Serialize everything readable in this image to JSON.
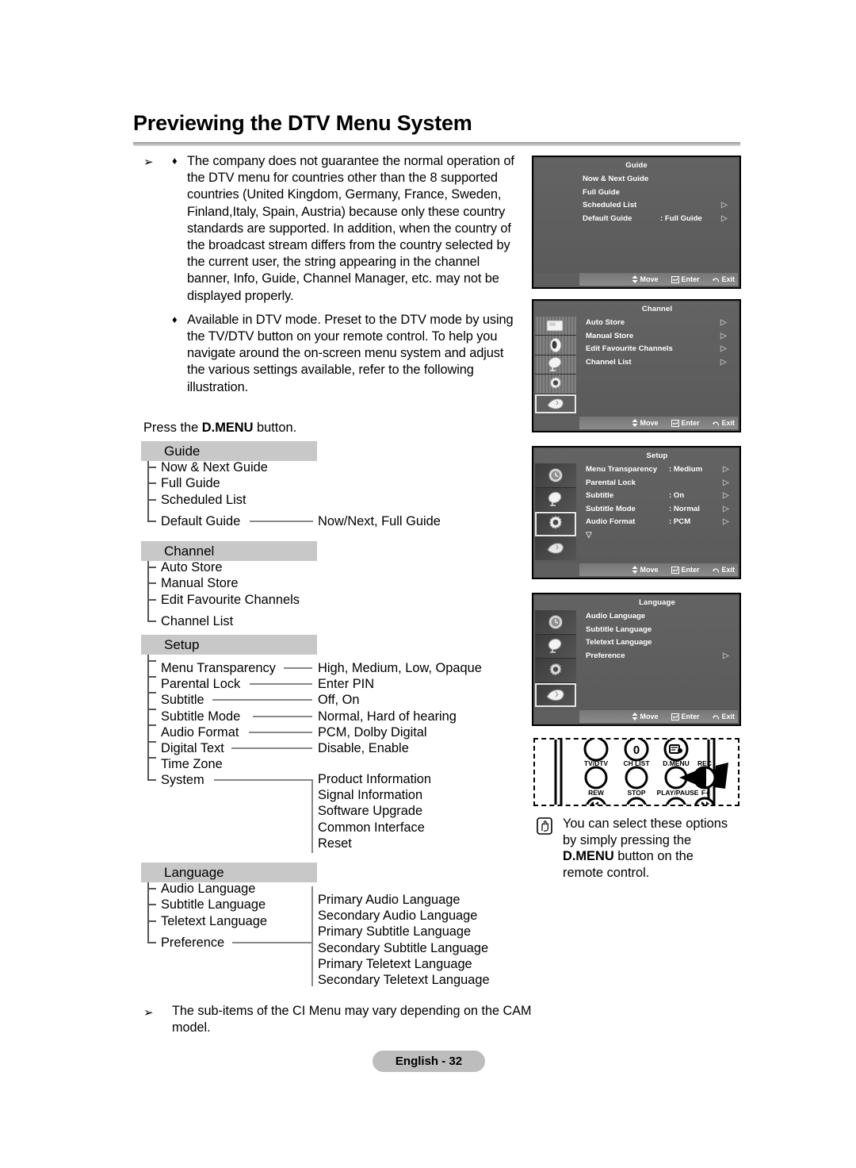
{
  "page": {
    "title": "Previewing the DTV Menu System",
    "footer_label": "English - 32"
  },
  "intro": {
    "arrow_glyph": "➢",
    "diamond_glyph": "♦",
    "bullets": [
      "The company does not guarantee the normal operation of the DTV menu for countries other than the 8 supported countries (United Kingdom, Germany, France, Sweden, Finland,Italy, Spain, Austria) because only these country standards are supported. In addition, when the country of the broadcast stream differs from the country selected by the current user, the string appearing in the channel banner, Info, Guide, Channel Manager, etc. may not be displayed properly.",
      "Available in DTV mode. Preset to the DTV mode by using the TV/DTV button on your remote control. To help you navigate around the on-screen menu system and adjust the various settings available, refer to the following illustration."
    ],
    "press_prefix": "Press the ",
    "press_bold": "D.MENU",
    "press_suffix": " button."
  },
  "tree": {
    "guide": {
      "header": "Guide",
      "items": [
        "Now & Next Guide",
        "Full Guide",
        "Scheduled List",
        "Default Guide"
      ],
      "default_guide_values": "Now/Next, Full Guide"
    },
    "channel": {
      "header": "Channel",
      "items": [
        "Auto Store",
        "Manual Store",
        "Edit Favourite Channels",
        "Channel List"
      ]
    },
    "setup": {
      "header": "Setup",
      "items": [
        "Menu Transparency",
        "Parental Lock",
        "Subtitle",
        "Subtitle Mode",
        "Audio Format",
        "Digital Text",
        "Time Zone",
        "System"
      ],
      "values": [
        "High, Medium, Low, Opaque",
        "Enter PIN",
        "Off, On",
        "Normal, Hard of hearing",
        "PCM, Dolby Digital",
        "Disable, Enable"
      ],
      "system_children": [
        "Product Information",
        "Signal Information",
        "Software Upgrade",
        "Common Interface",
        "Reset"
      ]
    },
    "language": {
      "header": "Language",
      "items": [
        "Audio Language",
        "Subtitle Language",
        "Teletext Language",
        "Preference"
      ],
      "preference_children": [
        "Primary Audio Language",
        "Secondary Audio Language",
        "Primary Subtitle Language",
        "Secondary Subtitle Language",
        "Primary Teletext Language",
        "Secondary Teletext Language"
      ]
    }
  },
  "osd": {
    "help": {
      "move": "Move",
      "enter": "Enter",
      "exit": "Exit"
    },
    "arrow_glyph": "▷",
    "down_glyph": "▽",
    "panels": [
      {
        "title": "Guide",
        "has_sidebar": false,
        "rows": [
          {
            "label": "Now & Next Guide",
            "value": "",
            "arrow": false
          },
          {
            "label": "Full Guide",
            "value": "",
            "arrow": false
          },
          {
            "label": "Scheduled List",
            "value": "",
            "arrow": true
          },
          {
            "label": "Default Guide",
            "value": ": Full Guide",
            "arrow": true
          }
        ]
      },
      {
        "title": "Channel",
        "has_sidebar": true,
        "sidebar_icons": [
          "picture-icon",
          "sound-icon",
          "dish-icon",
          "gear-icon",
          "hand-icon"
        ],
        "selected_icon": 4,
        "rows": [
          {
            "label": "Auto Store",
            "value": "",
            "arrow": true
          },
          {
            "label": "Manual Store",
            "value": "",
            "arrow": true
          },
          {
            "label": "Edit Favourite Channels",
            "value": "",
            "arrow": true
          },
          {
            "label": "Channel List",
            "value": "",
            "arrow": true
          }
        ]
      },
      {
        "title": "Setup",
        "has_sidebar": true,
        "sidebar_icons": [
          "clock-icon",
          "dish-icon",
          "gear-icon",
          "hand-icon"
        ],
        "selected_icon": 2,
        "rows": [
          {
            "label": "Menu Transparency",
            "value": ": Medium",
            "arrow": true
          },
          {
            "label": "Parental Lock",
            "value": "",
            "arrow": true
          },
          {
            "label": "Subtitle",
            "value": ": On",
            "arrow": true
          },
          {
            "label": "Subtitle  Mode",
            "value": ": Normal",
            "arrow": true
          },
          {
            "label": "Audio Format",
            "value": ": PCM",
            "arrow": true
          }
        ],
        "more_indicator": true
      },
      {
        "title": "Language",
        "has_sidebar": true,
        "sidebar_icons": [
          "clock-icon",
          "dish-icon",
          "gear-icon",
          "hand-icon"
        ],
        "selected_icon": 3,
        "rows": [
          {
            "label": "Audio Language",
            "value": "",
            "arrow": false
          },
          {
            "label": "Subtitle Language",
            "value": "",
            "arrow": false
          },
          {
            "label": "Teletext Language",
            "value": "",
            "arrow": false
          },
          {
            "label": "Preference",
            "value": "",
            "arrow": true
          }
        ]
      }
    ]
  },
  "remote": {
    "zero_label": "0",
    "row1_labels": [
      "TV/DTV",
      "CH LIST",
      "D.MENU",
      "REC"
    ],
    "row2_labels": [
      "REW",
      "STOP",
      "PLAY/PAUSE",
      "F+"
    ]
  },
  "note": {
    "line1": "You can select these options",
    "line2": "by simply pressing the",
    "line3_bold": "D.MENU",
    "line3_rest": " button on the",
    "line4": "remote control."
  },
  "bottom_note": {
    "arrow_glyph": "➢",
    "text": "The sub-items of the CI Menu may vary depending on the CAM model."
  }
}
